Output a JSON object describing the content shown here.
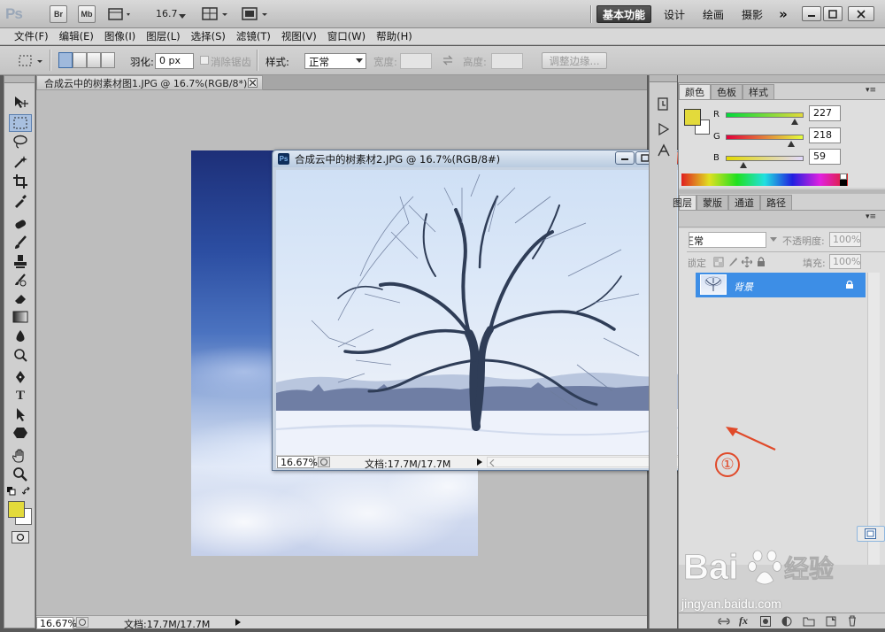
{
  "appbar": {
    "logo": "Ps",
    "btn_bridge": "Br",
    "btn_minibridge": "Mb",
    "zoom": "16.7",
    "workspaces": [
      "基本功能",
      "设计",
      "绘画",
      "摄影"
    ],
    "more": "»"
  },
  "menu": [
    "文件(F)",
    "编辑(E)",
    "图像(I)",
    "图层(L)",
    "选择(S)",
    "滤镜(T)",
    "视图(V)",
    "窗口(W)",
    "帮助(H)"
  ],
  "options": {
    "feather_label": "羽化:",
    "feather_value": "0 px",
    "antialias_label": "消除锯齿",
    "style_label": "样式:",
    "style_value": "正常",
    "width_label": "宽度:",
    "height_label": "高度:",
    "refine_edge": "调整边缘..."
  },
  "doc1": {
    "tab_title": "合成云中的树素材图1.JPG @ 16.7%(RGB/8*)",
    "zoom": "16.67%",
    "doc_size": "文档:17.7M/17.7M"
  },
  "doc2": {
    "title": "合成云中的树素材2.JPG @ 16.7%(RGB/8#)",
    "zoom": "16.67%",
    "doc_size": "文档:17.7M/17.7M"
  },
  "color_panel": {
    "tabs": [
      "颜色",
      "色板",
      "样式"
    ],
    "r_label": "R",
    "g_label": "G",
    "b_label": "B",
    "r": 227,
    "g": 218,
    "b": 59,
    "fg_color": "#e3da3b"
  },
  "layers_panel": {
    "tabs": [
      "图层",
      "蒙版",
      "通道",
      "路径"
    ],
    "blend_mode": "正常",
    "opacity_label": "不透明度:",
    "opacity": "100%",
    "lock_label": "锁定:",
    "fill_label": "填充:",
    "fill": "100%",
    "layer_name": "背景"
  },
  "annotation": {
    "marker": "①",
    "accent": "#e04a2a"
  },
  "watermark": {
    "brand": "Bai 经验",
    "url": "jingyan.baidu.com"
  }
}
